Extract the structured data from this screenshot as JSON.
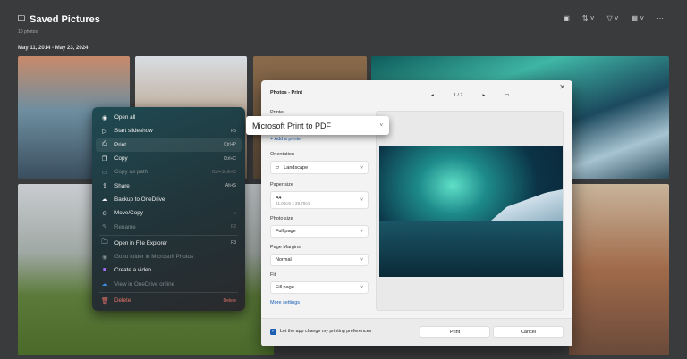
{
  "header": {
    "title": "Saved Pictures",
    "count": "10 photos",
    "date_range": "May 11, 2014 - May 23, 2024",
    "tools": [
      "slideshow-icon",
      "sort-icon",
      "filter-icon",
      "view-icon",
      "more-icon"
    ]
  },
  "context_menu": {
    "items": [
      {
        "label": "Open all",
        "shortcut": "",
        "icon": "eye-icon",
        "disabled": false
      },
      {
        "label": "Start slideshow",
        "shortcut": "F5",
        "icon": "slideshow-icon",
        "disabled": false
      },
      {
        "label": "Print",
        "shortcut": "Ctrl+P",
        "icon": "printer-icon",
        "disabled": false,
        "highlighted": true
      },
      {
        "label": "Copy",
        "shortcut": "Ctrl+C",
        "icon": "copy-icon",
        "disabled": false
      },
      {
        "label": "Copy as path",
        "shortcut": "Ctrl+Shift+C",
        "icon": "path-icon",
        "disabled": true
      },
      {
        "label": "Share",
        "shortcut": "Alt+S",
        "icon": "share-icon",
        "disabled": false
      },
      {
        "label": "Backup to OneDrive",
        "shortcut": "",
        "icon": "backup-icon",
        "disabled": false
      },
      {
        "label": "Move/Copy",
        "shortcut": "›",
        "icon": "move-icon",
        "disabled": false
      },
      {
        "label": "Rename",
        "shortcut": "F2",
        "icon": "rename-icon",
        "disabled": true
      },
      {
        "label": "Open in File Explorer",
        "shortcut": "F3",
        "icon": "folder-icon",
        "disabled": false
      },
      {
        "label": "Go to folder in Microsoft Photos",
        "shortcut": "",
        "icon": "eye-icon",
        "disabled": true
      },
      {
        "label": "Create a video",
        "shortcut": "",
        "icon": "video-icon",
        "disabled": false
      },
      {
        "label": "View in OneDrive online",
        "shortcut": "",
        "icon": "cloud-icon",
        "disabled": true
      },
      {
        "label": "Delete",
        "shortcut": "Delete",
        "icon": "trash-icon",
        "disabled": false,
        "danger": true
      }
    ]
  },
  "print_dialog": {
    "title": "Photos - Print",
    "page": "1 / 7",
    "printer_label": "Printer",
    "printer_value": "Microsoft Print to PDF",
    "add_printer": "Add a printer",
    "orientation_label": "Orientation",
    "orientation_value": "Landscape",
    "paper_label": "Paper size",
    "paper_value": "A4",
    "paper_dims": "21.00cm x 29.70cm",
    "photo_size_label": "Photo size",
    "photo_size_value": "Full page",
    "margins_label": "Page Margins",
    "margins_value": "Normal",
    "fit_label": "Fit",
    "fit_value": "Fill page",
    "more_settings": "More settings",
    "pref_checkbox": "Let the app change my printing preferences",
    "pref_checked": true,
    "print_button": "Print",
    "cancel_button": "Cancel"
  }
}
